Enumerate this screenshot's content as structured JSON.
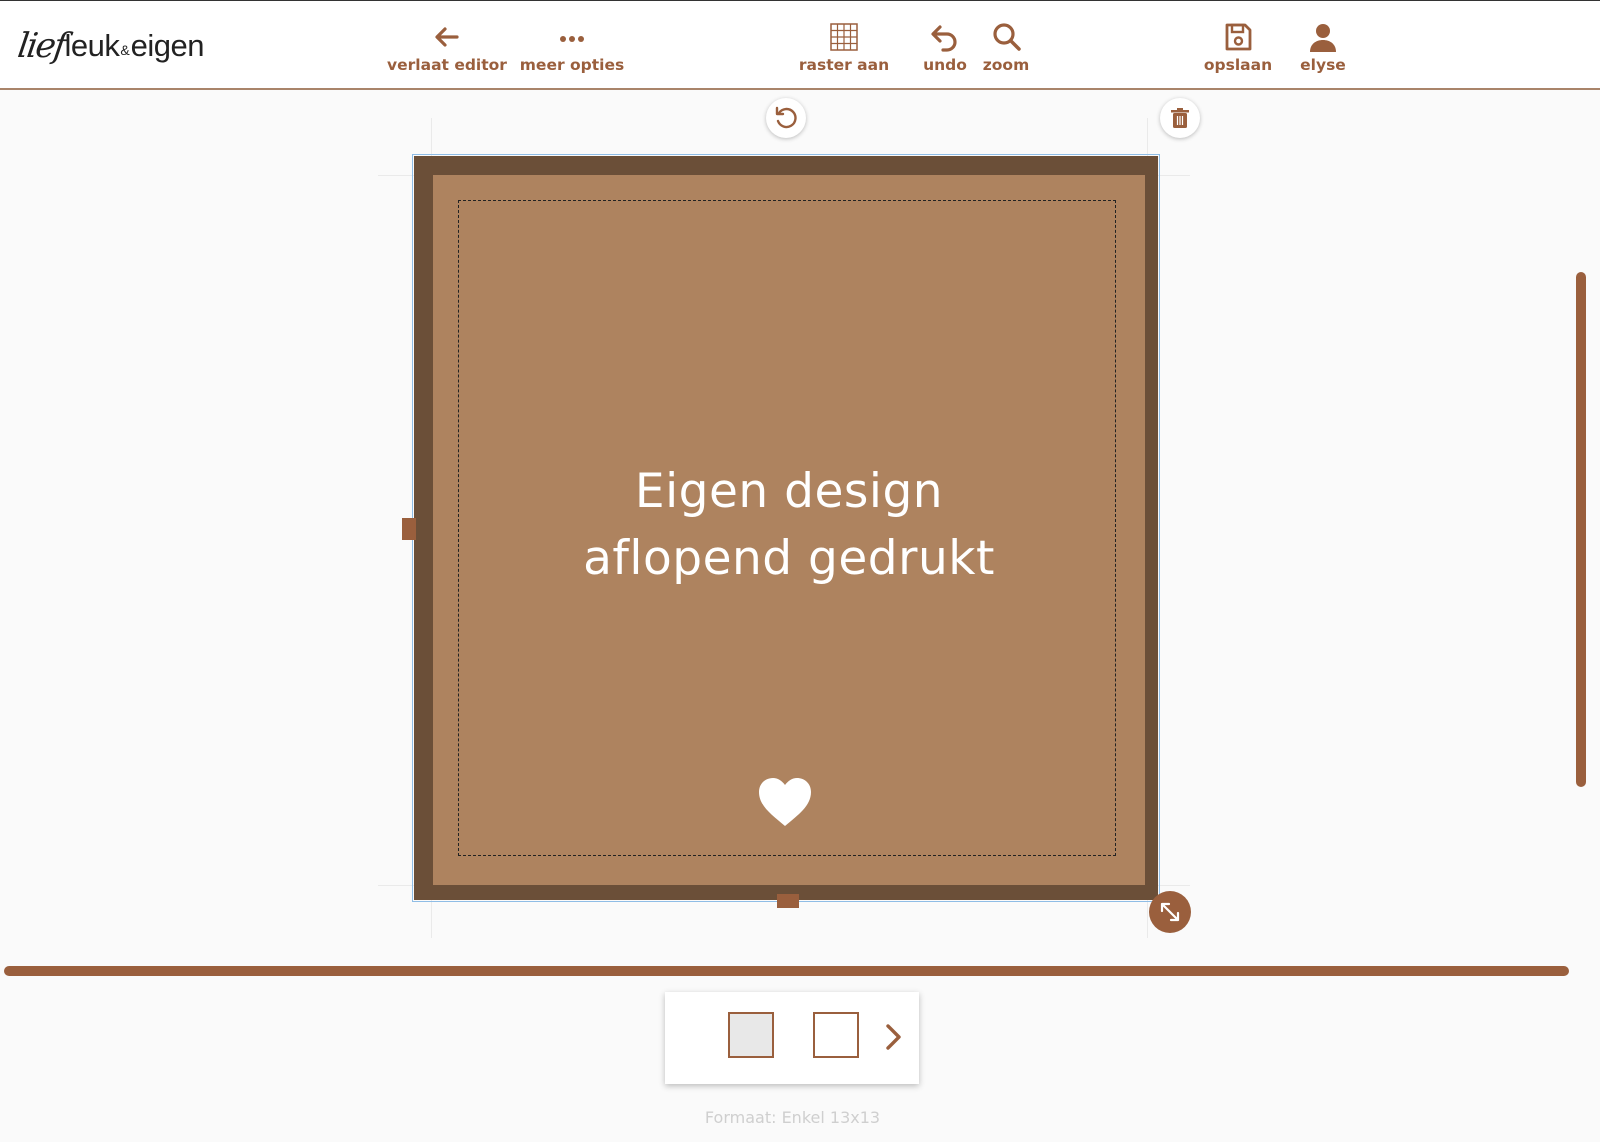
{
  "header": {
    "logo": {
      "script": "lief",
      "word1": "leuk",
      "amp": "&",
      "word2": "eigen"
    },
    "tools": {
      "leave_editor": "verlaat editor",
      "more_options": "meer opties",
      "grid_on": "raster aan",
      "undo": "undo",
      "zoom": "zoom",
      "save": "opslaan",
      "user": "elyse"
    },
    "icons": {
      "leave_editor": "arrow-left-icon",
      "more_options": "ellipsis-icon",
      "grid_on": "grid-icon",
      "undo": "undo-icon",
      "zoom": "search-icon",
      "save": "floppy-disk-icon",
      "user": "user-icon"
    }
  },
  "canvas": {
    "text_line1": "Eigen design",
    "text_line2": "aflopend gedrukt",
    "icons": [
      "rotate-icon",
      "trash-icon",
      "heart-icon",
      "resize-icon"
    ]
  },
  "pages": {
    "thumbnails": [
      {
        "label": "page-1",
        "selected": true
      },
      {
        "label": "page-2",
        "selected": false
      }
    ],
    "next_icon": "chevron-right-icon"
  },
  "footer": {
    "format": "Formaat: Enkel 13x13"
  },
  "colors": {
    "accent": "#9a5f3d",
    "card_border": "#6b4f38",
    "card_fill": "#ae835f",
    "selection": "#8fbde6",
    "background": "#fafafa"
  }
}
